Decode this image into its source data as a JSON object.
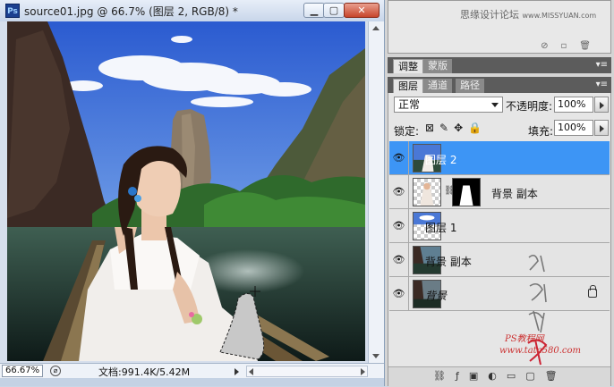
{
  "window": {
    "app_icon": "Ps",
    "title": "source01.jpg @ 66.7% (图层 2, RGB/8) *",
    "minimize": "▁",
    "maximize": "▢",
    "close": "✕"
  },
  "status": {
    "zoom": "66.67%",
    "doc_size": "文档:991.4K/5.42M"
  },
  "top_panel": {
    "watermark_cn": "思缘设计论坛",
    "watermark_url": "www.MISSYUAN.com"
  },
  "adjust_tabs": [
    {
      "label": "调整",
      "active": true
    },
    {
      "label": "蒙版",
      "active": false
    }
  ],
  "layer_tabs": [
    {
      "label": "图层",
      "active": true
    },
    {
      "label": "通道",
      "active": false
    },
    {
      "label": "路径",
      "active": false
    }
  ],
  "layers_panel": {
    "blend_mode": "正常",
    "opacity_label": "不透明度:",
    "opacity_value": "100%",
    "lock_label": "锁定:",
    "fill_label": "填充:",
    "fill_value": "100%"
  },
  "layers": [
    {
      "name": "图层 2",
      "selected": true,
      "visible": true,
      "thumb": "scene",
      "mask": false,
      "locked": false
    },
    {
      "name": "背景 副本",
      "selected": false,
      "visible": true,
      "thumb": "girl",
      "mask": true,
      "locked": false
    },
    {
      "name": "图层 1",
      "selected": false,
      "visible": true,
      "thumb": "checker",
      "mask": false,
      "locked": false
    },
    {
      "name": "背景 副本",
      "selected": false,
      "visible": true,
      "thumb": "scene",
      "mask": false,
      "locked": false
    },
    {
      "name": "背景",
      "selected": false,
      "visible": true,
      "thumb": "scene",
      "mask": false,
      "locked": true
    }
  ],
  "watermark_site": {
    "line1": "PS教程网",
    "line2": "www.tata580.com"
  },
  "colors": {
    "selection": "#3d95f5",
    "sky": "#3f6ed6",
    "panel_tab_bar": "#5c5c5c"
  }
}
